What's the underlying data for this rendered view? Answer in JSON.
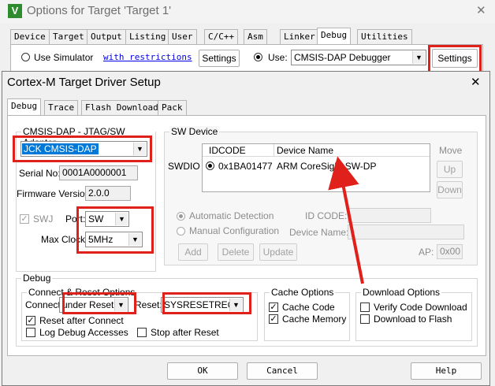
{
  "outer": {
    "title": "Options for Target 'Target 1'",
    "close": "✕",
    "icon_letter": "V",
    "tabs": [
      "Device",
      "Target",
      "Output",
      "Listing",
      "User",
      "C/C++",
      "Asm",
      "Linker",
      "Debug",
      "Utilities"
    ],
    "active_tab": "Debug",
    "use_simulator": "Use Simulator",
    "with_restrictions": "with restrictions",
    "settings_left": "Settings",
    "use": "Use:",
    "debugger": "CMSIS-DAP Debugger",
    "settings_right": "Settings"
  },
  "dialog": {
    "title": "Cortex-M Target Driver Setup",
    "close": "✕",
    "tabs": [
      "Debug",
      "Trace",
      "Flash Download",
      "Pack"
    ],
    "active_tab": "Debug",
    "adapter": {
      "group": "CMSIS-DAP - JTAG/SW Adapter",
      "selected": "JCK CMSIS-DAP",
      "serial_label": "Serial No:",
      "serial": "0001A0000001",
      "firmware_label": "Firmware Version:",
      "firmware": "2.0.0",
      "swj": "SWJ",
      "port_label": "Port:",
      "port": "SW",
      "max_clock_label": "Max Clock:",
      "max_clock": "5MHz"
    },
    "sw_device": {
      "group": "SW Device",
      "swdio": "SWDIO",
      "col_idcode": "IDCODE",
      "col_device": "Device Name",
      "row_idcode": "0x1BA01477",
      "row_device": "ARM CoreSight SW-DP",
      "move": "Move",
      "up": "Up",
      "down": "Down",
      "auto_detect": "Automatic Detection",
      "manual_config": "Manual Configuration",
      "id_code_label": "ID CODE:",
      "device_name_label": "Device Name:",
      "add": "Add",
      "delete": "Delete",
      "update": "Update",
      "ap_label": "AP:",
      "ap_value": "0x00"
    },
    "debug": {
      "group": "Debug",
      "connect_group": "Connect & Reset Options",
      "connect_label": "Connect:",
      "connect": "under Reset",
      "reset_label": "Reset:",
      "reset": "SYSRESETREQ",
      "reset_after_connect": "Reset after Connect",
      "log_debug": "Log Debug Accesses",
      "stop_after_reset": "Stop after Reset",
      "cache_group": "Cache Options",
      "cache_code": "Cache Code",
      "cache_memory": "Cache Memory",
      "download_group": "Download Options",
      "verify_download": "Verify Code Download",
      "download_flash": "Download to Flash"
    },
    "buttons": {
      "ok": "OK",
      "cancel": "Cancel",
      "help": "Help"
    }
  },
  "colors": {
    "highlight": "#e0201a",
    "selection": "#0078d7"
  }
}
